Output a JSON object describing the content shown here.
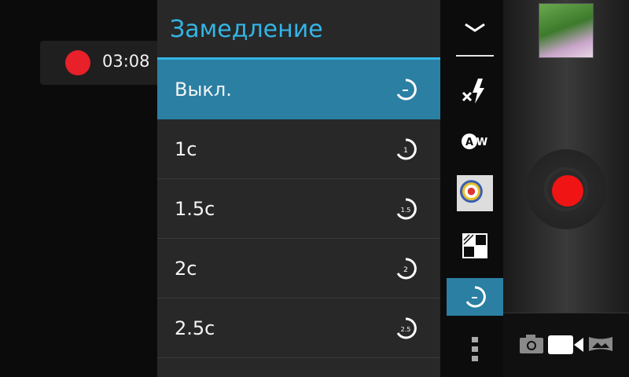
{
  "recording": {
    "time": "03:08",
    "indicator_color": "#e8202a"
  },
  "menu": {
    "title": "Замедление",
    "accent_color": "#33b5e5",
    "items": [
      {
        "label": "Выкл.",
        "icon": "timer-off-icon",
        "icon_text": "",
        "selected": true
      },
      {
        "label": "1с",
        "icon": "timer-1s-icon",
        "icon_text": "1",
        "selected": false
      },
      {
        "label": "1.5с",
        "icon": "timer-1-5s-icon",
        "icon_text": "1.5",
        "selected": false
      },
      {
        "label": "2с",
        "icon": "timer-2s-icon",
        "icon_text": "2",
        "selected": false
      },
      {
        "label": "2.5с",
        "icon": "timer-2-5s-icon",
        "icon_text": "2.5",
        "selected": false
      }
    ]
  },
  "toolbar": {
    "items": [
      {
        "icon": "chevron-down-icon"
      },
      {
        "icon": "flash-off-icon"
      },
      {
        "icon": "white-balance-auto-icon",
        "text": "Aw"
      },
      {
        "icon": "color-effect-thumbnail-icon"
      },
      {
        "icon": "scene-mode-icon"
      },
      {
        "icon": "time-lapse-icon",
        "selected": true
      },
      {
        "icon": "more-options-icon"
      }
    ]
  },
  "shutter": {
    "button_color": "#f11414",
    "last_photo_icon": "gallery-thumbnail"
  },
  "modes": [
    "camera-mode-icon",
    "video-mode-icon",
    "panorama-mode-icon"
  ]
}
